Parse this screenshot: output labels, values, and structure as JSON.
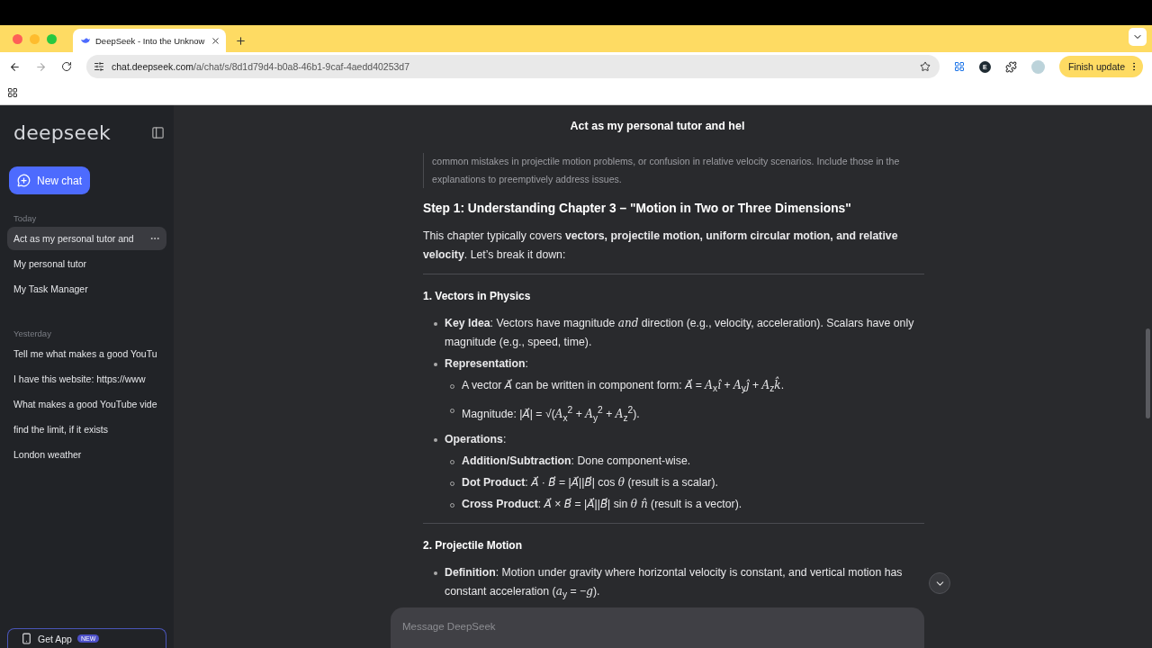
{
  "browser": {
    "tab": {
      "title": "DeepSeek - Into the Unknow"
    },
    "url": {
      "host": "chat.deepseek.com",
      "path": "/a/chat/s/8d1d79d4-b0a8-46b1-9caf-4aedd40253d7"
    },
    "profile_letter": "E",
    "update_button": "Finish update"
  },
  "sidebar": {
    "logo": "deepseek",
    "new_chat": "New chat",
    "groups": [
      {
        "label": "Today",
        "items": [
          {
            "title": "Act as my personal tutor and",
            "selected": true
          },
          {
            "title": "My personal tutor",
            "selected": false
          },
          {
            "title": "My Task Manager",
            "selected": false
          }
        ]
      },
      {
        "label": "Yesterday",
        "items": [
          {
            "title": "Tell me what makes a good YouTu",
            "selected": false
          },
          {
            "title": "I have this website: https://www",
            "selected": false
          },
          {
            "title": "What makes a good YouTube vide",
            "selected": false
          },
          {
            "title": "find the limit, if it exists",
            "selected": false
          },
          {
            "title": "London weather",
            "selected": false
          }
        ]
      }
    ],
    "get_app": {
      "label": "Get App",
      "badge": "NEW"
    }
  },
  "chat": {
    "title": "Act as my personal tutor and hel",
    "blocks": [
      {
        "kind": "quote",
        "text": "common mistakes in projectile motion problems, or confusion in relative velocity scenarios. Include those in the explanations to preemptively address issues."
      },
      {
        "kind": "heading",
        "text": "Step 1: Understanding Chapter 3 – \"Motion in Two or Three Dimensions\""
      },
      {
        "kind": "paragraph",
        "text": "This chapter typically covers **vectors, projectile motion, uniform circular motion, and relative velocity**. Let’s break it down:"
      },
      {
        "kind": "rule"
      },
      {
        "kind": "subheading",
        "text": "1. Vectors in Physics"
      },
      {
        "kind": "list",
        "items": [
          {
            "text": "**Key Idea**: Vectors have magnitude *and* direction (e.g., velocity, acceleration). Scalars have only magnitude (e.g., speed, time)."
          },
          {
            "text": "**Representation**:",
            "children": [
              {
                "text": "A vector *A⃗* can be written in component form: *A⃗* = *A*$_{x}$*î* + *A*$_{y}$*ĵ* + *A*$_{z}$*k̂*."
              },
              {
                "text": "Magnitude: |*A⃗*| = √(*A*$_{x}$$^{2}$ + *A*$_{y}$$^{2}$ + *A*$_{z}$$^{2}$)."
              }
            ]
          },
          {
            "text": "**Operations**:",
            "children": [
              {
                "text": "**Addition/Subtraction**: Done component-wise."
              },
              {
                "text": "**Dot Product**: *A⃗* · *B⃗* = |*A⃗*||*B⃗*| cos *θ* (result is a scalar)."
              },
              {
                "text": "**Cross Product**: *A⃗* × *B⃗* = |*A⃗*||*B⃗*| sin *θ n̂* (result is a vector)."
              }
            ]
          }
        ]
      },
      {
        "kind": "rule"
      },
      {
        "kind": "subheading",
        "text": "2. Projectile Motion"
      },
      {
        "kind": "list",
        "items": [
          {
            "text": "**Definition**: Motion under gravity where horizontal velocity is constant, and vertical motion has constant acceleration (*a*$_{y}$ = −*g*)."
          }
        ]
      }
    ],
    "input": {
      "placeholder": "Message DeepSeek"
    }
  }
}
